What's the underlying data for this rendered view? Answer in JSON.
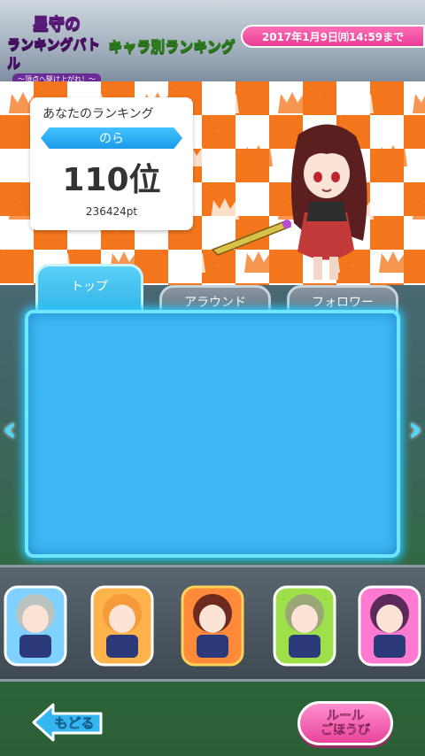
{
  "header": {
    "logo_line1": "星守の",
    "logo_line2": "ランキングバトル",
    "logo_subtitle": "〜頂点へ駆け上がれ！〜",
    "title": "キャラ別ランキング",
    "deadline": "2017年1月9日㈪14:59まで"
  },
  "my_ranking": {
    "label": "あなたのランキング",
    "name": "のら",
    "rank": "110位",
    "points": "236424pt"
  },
  "tabs": [
    {
      "label": "トップ",
      "active": true
    },
    {
      "label": "アラウンド",
      "active": false
    },
    {
      "label": "フォロワー",
      "active": false
    }
  ],
  "nav": {
    "left_arrow": "‹",
    "right_arrow": "›"
  },
  "characters": [
    {
      "icon": "character-icon-gray-hair",
      "color": "#b9c2bf"
    },
    {
      "icon": "character-icon-orange-hair",
      "color": "#f59b3a"
    },
    {
      "icon": "character-icon-dark-hair-selected",
      "color": "#6e2a1e"
    },
    {
      "icon": "character-icon-green-hair",
      "color": "#9aa877"
    },
    {
      "icon": "character-icon-purple-hair",
      "color": "#5a2a58"
    }
  ],
  "buttons": {
    "back": "もどる",
    "rule_line1": "ルール",
    "rule_line2": "ごほうび"
  },
  "colors": {
    "accent_blue": "#3db7f4",
    "checker_orange": "#f3761c",
    "pink": "#e8449a"
  }
}
